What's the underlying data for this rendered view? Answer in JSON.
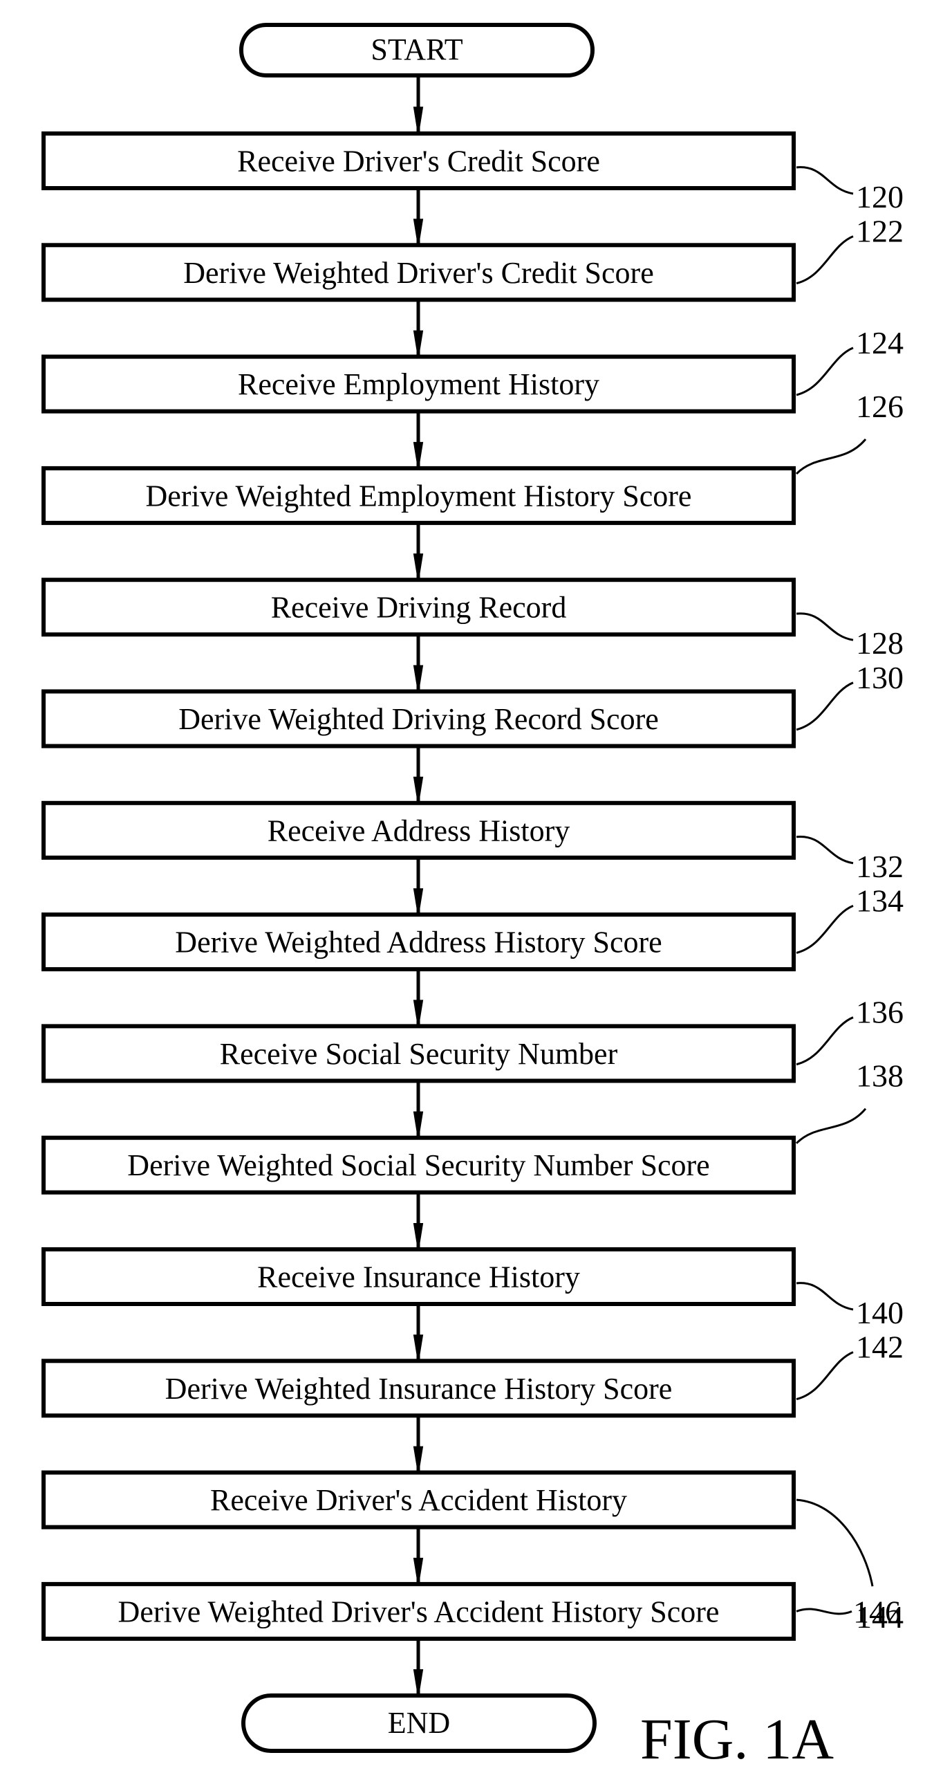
{
  "figure_label": "FIG. 1A",
  "start": {
    "label": "START"
  },
  "end": {
    "label": "END"
  },
  "steps": [
    {
      "ref": "120",
      "label": "Receive Driver's Credit Score",
      "leader": "below"
    },
    {
      "ref": "122",
      "label": "Derive Weighted Driver's Credit Score",
      "leader": "above"
    },
    {
      "ref": "124",
      "label": "Receive Employment History",
      "leader": "above"
    },
    {
      "ref": "126",
      "label": "Derive Weighted Employment History Score",
      "leader": "above-high"
    },
    {
      "ref": "128",
      "label": "Receive Driving Record",
      "leader": "below"
    },
    {
      "ref": "130",
      "label": "Derive Weighted Driving Record Score",
      "leader": "above"
    },
    {
      "ref": "132",
      "label": "Receive Address History",
      "leader": "below"
    },
    {
      "ref": "134",
      "label": "Derive Weighted Address History Score",
      "leader": "above"
    },
    {
      "ref": "136",
      "label": "Receive Social Security Number",
      "leader": "above"
    },
    {
      "ref": "138",
      "label": "Derive Weighted Social Security Number Score",
      "leader": "above-high"
    },
    {
      "ref": "140",
      "label": "Receive Insurance History",
      "leader": "below"
    },
    {
      "ref": "142",
      "label": "Derive Weighted Insurance History Score",
      "leader": "above"
    },
    {
      "ref": "144",
      "label": "Receive Driver's Accident History",
      "leader": "below-far"
    },
    {
      "ref": "146",
      "label": "Derive Weighted Driver's Accident History Score",
      "leader": "side"
    }
  ]
}
